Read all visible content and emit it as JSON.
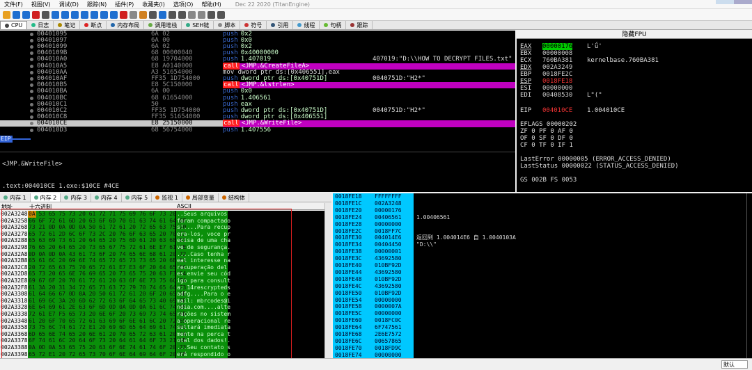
{
  "menu": [
    "文件(F)",
    "视图(V)",
    "调试(D)",
    "跟踪(N)",
    "插件(P)",
    "收藏夹(I)",
    "选项(O)",
    "帮助(H)"
  ],
  "menu_date": "Dec 22 2020 (TitanEngine)",
  "tabs": [
    "CPU",
    "日志",
    "笔记",
    "断点",
    "内存布局",
    "调用堆栈",
    "SEH链",
    "脚本",
    "符号",
    "引用",
    "线程",
    "句柄",
    "跟踪"
  ],
  "disasm": [
    {
      "a": "00401095",
      "h": "6A 02",
      "t": "push",
      "o": "0x2",
      "c": ""
    },
    {
      "a": "00401097",
      "h": "6A 00",
      "t": "push",
      "o": "0x0",
      "c": ""
    },
    {
      "a": "00401099",
      "h": "6A 02",
      "t": "push",
      "o": "0x2",
      "c": ""
    },
    {
      "a": "0040109B",
      "h": "68 00000040",
      "t": "push",
      "o": "0x40000000",
      "c": ""
    },
    {
      "a": "004010A0",
      "h": "68 19704000",
      "t": "push",
      "o": "1.407019",
      "c": "407019:\"D:\\\\HOW TO DECRYPT FILES.txt\""
    },
    {
      "a": "004010A5",
      "h": "E8 A0140000",
      "t": "call",
      "o": "<JMP.&CreateFileA>",
      "c": ""
    },
    {
      "a": "004010AA",
      "h": "A3 51654000",
      "t": "mov",
      "o": "mov dword ptr ds:[0x406551],eax",
      "c": ""
    },
    {
      "a": "004010AF",
      "h": "FF35 1D754000",
      "t": "push",
      "o": "dword ptr ds:[0x40751D]",
      "c": "0040751D:\"H2*\""
    },
    {
      "a": "004010B5",
      "h": "E8 5C150000",
      "t": "call",
      "o": "<JMP.&lstrlen>",
      "c": ""
    },
    {
      "a": "004010BA",
      "h": "6A 00",
      "t": "push",
      "o": "0x0",
      "c": ""
    },
    {
      "a": "004010BC",
      "h": "68 61654000",
      "t": "push",
      "o": "1.406561",
      "c": ""
    },
    {
      "a": "004010C1",
      "h": "50",
      "t": "push",
      "o": "eax",
      "c": ""
    },
    {
      "a": "004010C2",
      "h": "FF35 1D754000",
      "t": "push",
      "o": "dword ptr ds:[0x40751D]",
      "c": "0040751D:\"H2*\""
    },
    {
      "a": "004010C8",
      "h": "FF35 51654000",
      "t": "push",
      "o": "dword ptr ds:[0x406551]",
      "c": ""
    },
    {
      "a": "004010CE",
      "h": "E8 25150000",
      "t": "call",
      "o": "<JMP.&WriteFile>",
      "c": "",
      "cur": true
    },
    {
      "a": "004010D3",
      "h": "68 56754000",
      "t": "push",
      "o": "1.407556",
      "c": ""
    }
  ],
  "eip_label": "EIP",
  "info": {
    "line1": "<JMP.&WriteFile>",
    "line2": ".text:004010CE 1.exe:$10CE #4CE"
  },
  "reg_title": "隐藏FPU",
  "regs": [
    {
      "n": "EAX",
      "v": "00000176",
      "c": "L'ǘ'",
      "hl": true
    },
    {
      "n": "EBX",
      "v": "00000008",
      "c": ""
    },
    {
      "n": "ECX",
      "v": "760BA381",
      "c": "kernelbase.760BA381"
    },
    {
      "n": "EDX",
      "v": "002A3249",
      "c": ""
    },
    {
      "n": "EBP",
      "v": "0018FE2C",
      "c": ""
    },
    {
      "n": "ESP",
      "v": "0018FE18",
      "c": "",
      "red": true
    },
    {
      "n": "ESI",
      "v": "00000000",
      "c": ""
    },
    {
      "n": "EDI",
      "v": "00408530",
      "c": "L\"(\""
    },
    {
      "n": "EIP",
      "v": "004010CE",
      "c": "1.004010CE",
      "red": true
    }
  ],
  "flags": {
    "eflags": "EFLAGS  00000202",
    "r1": "ZF 0  PF 0  AF 0",
    "r2": "OF 0  SF 0  DF 0",
    "r3": "CF 0  TF 0  IF 1"
  },
  "errors": {
    "l1": "LastError  00000005 (ERROR_ACCESS_DENIED)",
    "l2": "LastStatus 00000022 (STATUS_ACCESS_DENIED)",
    "l3": "GS 002B  FS 0053"
  },
  "memtabs": [
    "内存 1",
    "内存 2",
    "内存 3",
    "内存 4",
    "内存 5",
    "监视 1",
    "局部变量",
    "结构体"
  ],
  "dumphdr": {
    "addr": "地址",
    "hex": "十六进制",
    "ascii": "ASCII"
  },
  "dump": [
    {
      "a": "002A3248",
      "h": "0A 53 65 75 73 20 61 72 71 75 69 76 6F 73 20",
      "s": "..Seus arquivos"
    },
    {
      "a": "002A3258",
      "h": "66 6F 72 61 6D 20 63 6F 6D 70 61 63 74 61 64 6F",
      "s": "foram compactado"
    },
    {
      "a": "002A3268",
      "h": "73 21 0D 0A 0D 0A 50 61 72 61 20 72 65 63 75 70",
      "s": "s!....Para recup"
    },
    {
      "a": "002A3278",
      "h": "65 72 61 2D 6C 6F 73 2C 20 76 6F 63 65 20 70 72",
      "s": "era-los, voce pr"
    },
    {
      "a": "002A3288",
      "h": "65 63 69 73 61 20 64 65 20 75 6D 61 20 63 68 61",
      "s": "ecisa de uma cha"
    },
    {
      "a": "002A3298",
      "h": "76 65 20 64 65 20 73 65 67 75 72 61 6E E7 61 2E",
      "s": "ve de segurança."
    },
    {
      "a": "002A32A8",
      "h": "0D 0A 0D 0A 43 61 73 6F 20 74 65 6E 68 61 20 72",
      "s": "....Caso tenha r"
    },
    {
      "a": "002A32B8",
      "h": "65 61 6C 20 69 6E 74 65 72 65 73 73 65 20 6E 61",
      "s": "eal interesse na"
    },
    {
      "a": "002A32C8",
      "h": "20 72 65 63 75 70 65 72 61 E7 E3 6F 20 64 65 6C",
      "s": " recuperação del"
    },
    {
      "a": "002A32D8",
      "h": "65 73 20 65 6E 76 69 65 20 73 65 75 20 63 F3 64",
      "s": "es envie seu cód"
    },
    {
      "a": "002A32E8",
      "h": "69 67 6F 20 70 61 72 61 20 63 6F 6E 73 75 6C 74",
      "s": "igo para consult"
    },
    {
      "a": "002A32F8",
      "h": "61 3A 20 31 34 72 65 73 63 72 79 70 74 65 64 73",
      "s": "a: 14rescrypteds"
    },
    {
      "a": "002A3308",
      "h": "61 64 66 67 0D 0A 20 50 61 72 61 20 6F 20 65 6D",
      "s": "adfg....Para o e"
    },
    {
      "a": "002A3318",
      "h": "61 69 6C 3A 20 6D 62 72 63 6F 64 65 73 40 69 6E",
      "s": "mail: mbrcodes@i"
    },
    {
      "a": "002A3328",
      "h": "6E 64 69 61 2E 63 6F 6D 0D 0A 0D 0A 61 6C 74 65",
      "s": "ndia.com....alte"
    },
    {
      "a": "002A3338",
      "h": "72 61 E7 F5 65 73 20 6E 6F 20 73 69 73 74 65 6D",
      "s": "rações no sistem"
    },
    {
      "a": "002A3348",
      "h": "61 20 6F 70 65 72 61 63 69 6F 6E 61 6C 20 72 65",
      "s": "a operacional re"
    },
    {
      "a": "002A3358",
      "h": "73 75 6C 74 61 72 E1 20 69 6D 65 64 69 61 74 61",
      "s": "sultará imediata"
    },
    {
      "a": "002A3368",
      "h": "6D 65 6E 74 65 20 6E 61 20 70 65 72 63 61 20 74",
      "s": "mente na perca t"
    },
    {
      "a": "002A3378",
      "h": "6F 74 61 6C 20 64 6F 73 20 64 61 64 6F 73 21 0D",
      "s": "otal dos dados!."
    },
    {
      "a": "002A3388",
      "h": "0A 0D 0A 53 65 75 20 63 6F 6E 74 61 74 6F 20 73",
      "s": "...Seu contato s"
    },
    {
      "a": "002A3398",
      "h": "65 72 E1 20 72 65 73 70 6F 6E 64 69 64 6F 20 6F",
      "s": "erá respondido o"
    }
  ],
  "stack": [
    {
      "a": "0018FE18",
      "v": "FFFFFFFF",
      "c": ""
    },
    {
      "a": "0018FE1C",
      "v": "002A3248",
      "c": ""
    },
    {
      "a": "0018FE20",
      "v": "00000176",
      "c": ""
    },
    {
      "a": "0018FE24",
      "v": "00406561",
      "c": "1.00406561"
    },
    {
      "a": "0018FE28",
      "v": "00000000",
      "c": ""
    },
    {
      "a": "0018FE2C",
      "v": "0018FF7C",
      "c": ""
    },
    {
      "a": "0018FE30",
      "v": "004014E6",
      "c": "返回到 1.004014E6 自 1.0040103A",
      "red": true
    },
    {
      "a": "0018FE34",
      "v": "00404450",
      "c": "\"D:\\\\\""
    },
    {
      "a": "0018FE38",
      "v": "00000001",
      "c": ""
    },
    {
      "a": "0018FE3C",
      "v": "43692580",
      "c": ""
    },
    {
      "a": "0018FE40",
      "v": "010BF92D",
      "c": ""
    },
    {
      "a": "0018FE44",
      "v": "43692580",
      "c": ""
    },
    {
      "a": "0018FE48",
      "v": "010BF92D",
      "c": ""
    },
    {
      "a": "0018FE4C",
      "v": "43692580",
      "c": ""
    },
    {
      "a": "0018FE50",
      "v": "010BF92D",
      "c": ""
    },
    {
      "a": "0018FE54",
      "v": "00000000",
      "c": ""
    },
    {
      "a": "0018FE58",
      "v": "0000007A",
      "c": ""
    },
    {
      "a": "0018FE5C",
      "v": "00000000",
      "c": ""
    },
    {
      "a": "0018FE60",
      "v": "0018FC0C",
      "c": ""
    },
    {
      "a": "0018FE64",
      "v": "6F747561",
      "c": ""
    },
    {
      "a": "0018FE68",
      "v": "2E6E7572",
      "c": ""
    },
    {
      "a": "0018FE6C",
      "v": "00657865",
      "c": ""
    },
    {
      "a": "0018FE70",
      "v": "0018FD9C",
      "c": ""
    },
    {
      "a": "0018FE74",
      "v": "00000000",
      "c": ""
    }
  ],
  "status": {
    "select": "默认"
  }
}
